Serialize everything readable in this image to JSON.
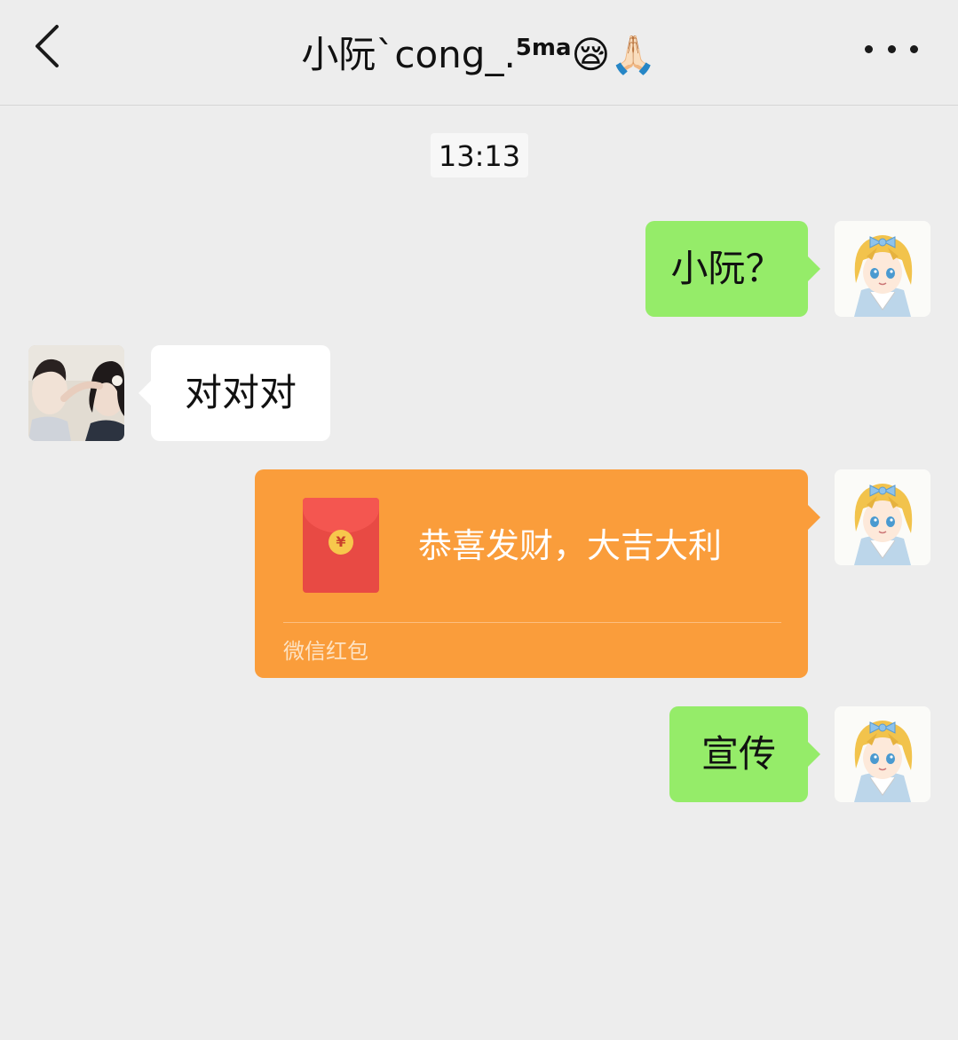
{
  "header": {
    "title_main": "小阮`cong_.",
    "title_sup": "5ma",
    "title_emoji": "😪🙏🏻",
    "back_icon": "chevron-left-icon",
    "more_icon": "more-dots-icon"
  },
  "timestamp": "13:13",
  "messages": [
    {
      "sender": "self",
      "type": "text",
      "text": "小阮？"
    },
    {
      "sender": "other",
      "type": "text",
      "text": "对对对"
    },
    {
      "sender": "self",
      "type": "red_packet",
      "greeting": "恭喜发财，大吉大利",
      "label": "微信红包",
      "coin_symbol": "¥"
    },
    {
      "sender": "self",
      "type": "text",
      "text": "宣传"
    }
  ],
  "colors": {
    "background": "#ededed",
    "self_bubble": "#95ec69",
    "other_bubble": "#ffffff",
    "red_packet": "#fa9d3b",
    "red_packet_envelope": "#e84a44"
  }
}
